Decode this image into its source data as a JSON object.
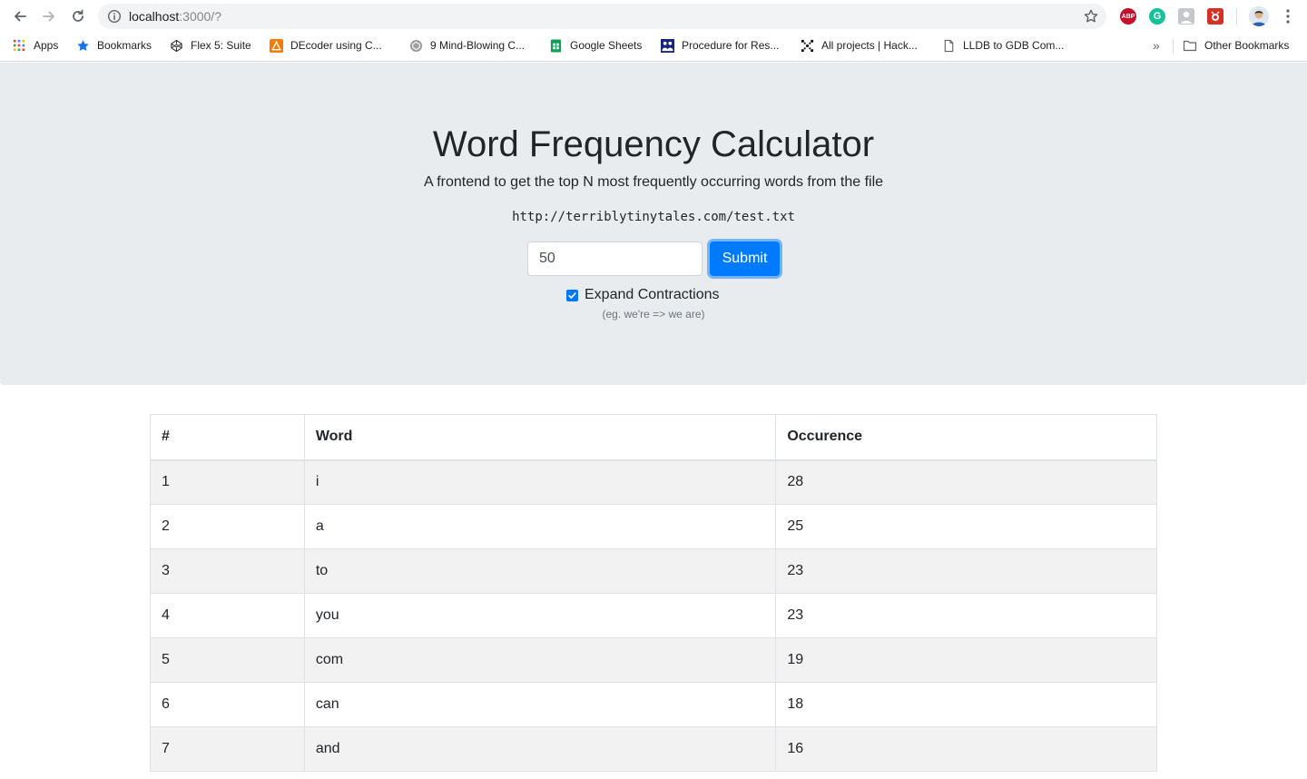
{
  "browser": {
    "url_host": "localhost",
    "url_rest": ":3000/?",
    "bookmarks": [
      {
        "label": "Apps",
        "icon": "apps-grid-icon"
      },
      {
        "label": "Bookmarks",
        "icon": "star-icon"
      },
      {
        "label": "Flex 5: Suite",
        "icon": "codepen-icon"
      },
      {
        "label": "DEcoder using C...",
        "icon": "orange-triangle-icon"
      },
      {
        "label": "9 Mind-Blowing C...",
        "icon": "codepen-icon"
      },
      {
        "label": "Google Sheets",
        "icon": "sheets-icon"
      },
      {
        "label": "Procedure for Res...",
        "icon": "people-icon"
      },
      {
        "label": "All projects | Hack...",
        "icon": "hackaday-icon"
      },
      {
        "label": "LLDB to GDB Com...",
        "icon": "document-icon"
      }
    ],
    "other_bookmarks": "Other Bookmarks",
    "extensions": {
      "abp": "ABP",
      "grammarly": "G"
    },
    "colors": {
      "omnibox": "#f1f3f4",
      "abp": "#c70d2c",
      "grammarly": "#15c39a"
    }
  },
  "page": {
    "title": "Word Frequency Calculator",
    "lead": "A frontend to get the top N most frequently occurring words from the file",
    "source_url": "http://terriblytinytales.com/test.txt",
    "input_value": "50",
    "submit_label": "Submit",
    "checkbox_checked": true,
    "checkbox_label": "Expand Contractions",
    "hint": "(eg. we're => we are)",
    "colors": {
      "jumbotron": "#e9ecef",
      "primary": "#007bff"
    }
  },
  "table": {
    "headers": [
      "#",
      "Word",
      "Occurence"
    ],
    "rows": [
      [
        "1",
        "i",
        "28"
      ],
      [
        "2",
        "a",
        "25"
      ],
      [
        "3",
        "to",
        "23"
      ],
      [
        "4",
        "you",
        "23"
      ],
      [
        "5",
        "com",
        "19"
      ],
      [
        "6",
        "can",
        "18"
      ],
      [
        "7",
        "and",
        "16"
      ]
    ]
  }
}
